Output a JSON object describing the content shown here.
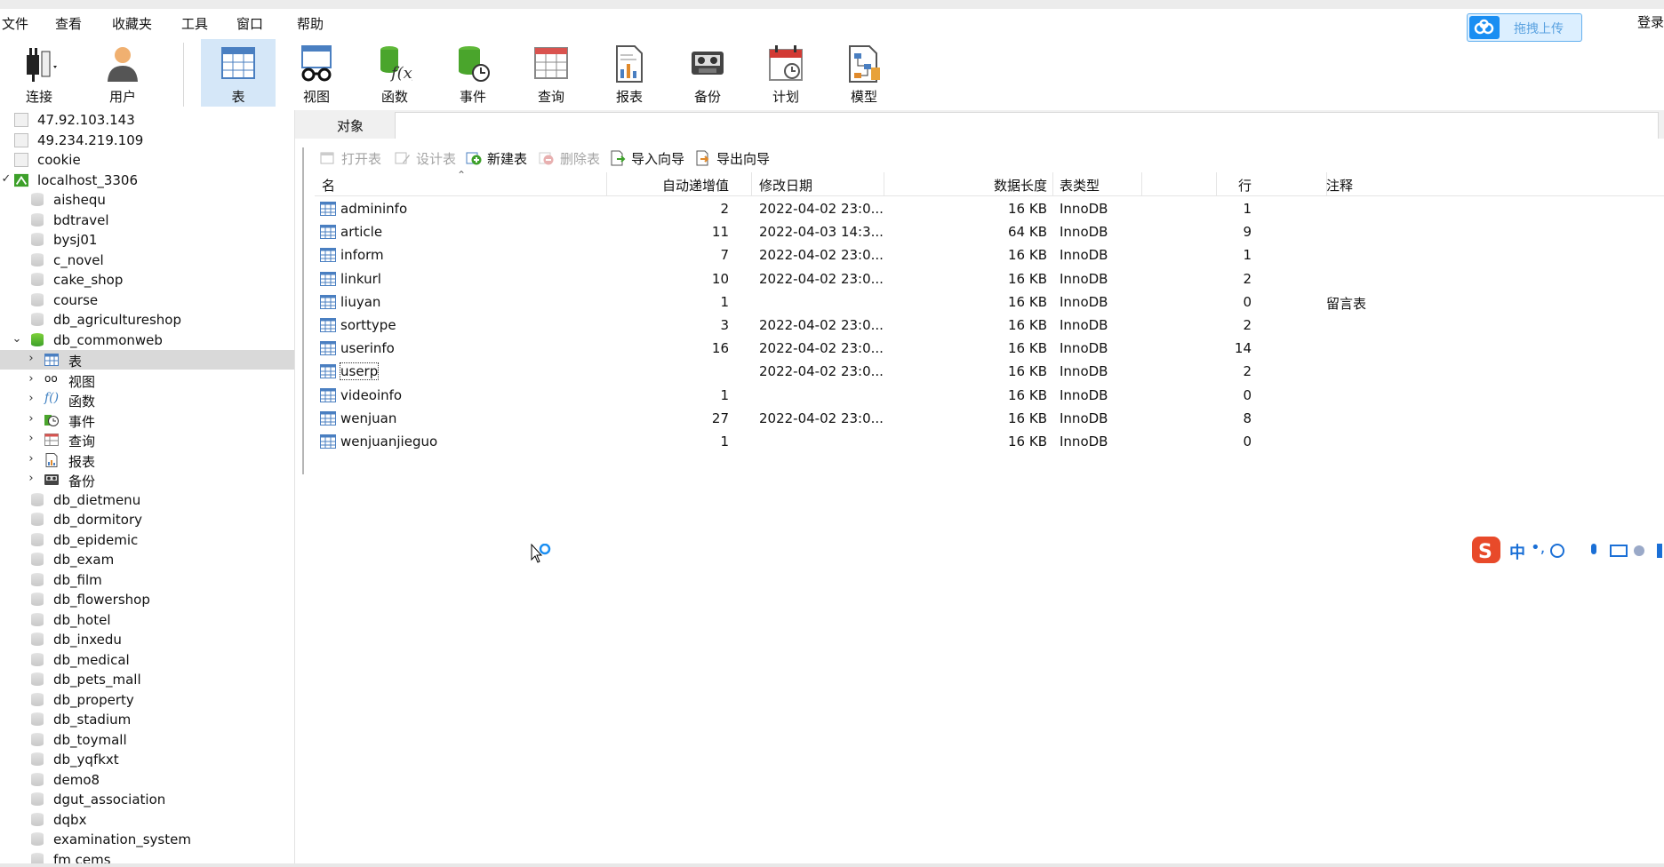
{
  "menu": [
    "文件",
    "查看",
    "收藏夹",
    "工具",
    "窗口",
    "帮助"
  ],
  "login": "登录",
  "upload": {
    "label": "拖拽上传"
  },
  "toolbar": {
    "connect": "连接",
    "user": "用户",
    "table": "表",
    "view": "视图",
    "function": "函数",
    "event": "事件",
    "query": "查询",
    "report": "报表",
    "backup": "备份",
    "schedule": "计划",
    "model": "模型"
  },
  "sidebar": {
    "connections": [
      "47.92.103.143",
      "49.234.219.109",
      "cookie",
      "localhost_3306"
    ],
    "dbs_before": [
      "aishequ",
      "bdtravel",
      "bysj01",
      "c_novel",
      "cake_shop",
      "course",
      "db_agricultureshop"
    ],
    "open_db": "db_commonweb",
    "children": [
      "表",
      "视图",
      "函数",
      "事件",
      "查询",
      "报表",
      "备份"
    ],
    "dbs_after": [
      "db_dietmenu",
      "db_dormitory",
      "db_epidemic",
      "db_exam",
      "db_film",
      "db_flowershop",
      "db_hotel",
      "db_inxedu",
      "db_medical",
      "db_pets_mall",
      "db_property",
      "db_stadium",
      "db_toymall",
      "db_yqfkxt",
      "demo8",
      "dgut_association",
      "dqbx",
      "examination_system",
      "fm cems"
    ]
  },
  "tab": {
    "objects": "对象"
  },
  "objtoolbar": {
    "open": "打开表",
    "design": "设计表",
    "new": "新建表",
    "delete": "删除表",
    "import": "导入向导",
    "export": "导出向导"
  },
  "columns": {
    "name": "名",
    "auto_inc": "自动递增值",
    "modified": "修改日期",
    "data_length": "数据长度",
    "engine": "表类型",
    "rows": "行",
    "comment": "注释"
  },
  "tables": [
    {
      "name": "admininfo",
      "auto_inc": "2",
      "modified": "2022-04-02 23:0...",
      "data_length": "16 KB",
      "engine": "InnoDB",
      "rows": "1",
      "comment": ""
    },
    {
      "name": "article",
      "auto_inc": "11",
      "modified": "2022-04-03 14:3...",
      "data_length": "64 KB",
      "engine": "InnoDB",
      "rows": "9",
      "comment": ""
    },
    {
      "name": "inform",
      "auto_inc": "7",
      "modified": "2022-04-02 23:0...",
      "data_length": "16 KB",
      "engine": "InnoDB",
      "rows": "1",
      "comment": ""
    },
    {
      "name": "linkurl",
      "auto_inc": "10",
      "modified": "2022-04-02 23:0...",
      "data_length": "16 KB",
      "engine": "InnoDB",
      "rows": "2",
      "comment": ""
    },
    {
      "name": "liuyan",
      "auto_inc": "1",
      "modified": "",
      "data_length": "16 KB",
      "engine": "InnoDB",
      "rows": "0",
      "comment": "留言表"
    },
    {
      "name": "sorttype",
      "auto_inc": "3",
      "modified": "2022-04-02 23:0...",
      "data_length": "16 KB",
      "engine": "InnoDB",
      "rows": "2",
      "comment": ""
    },
    {
      "name": "userinfo",
      "auto_inc": "16",
      "modified": "2022-04-02 23:0...",
      "data_length": "16 KB",
      "engine": "InnoDB",
      "rows": "14",
      "comment": ""
    },
    {
      "name": "userp",
      "auto_inc": "",
      "modified": "2022-04-02 23:0...",
      "data_length": "16 KB",
      "engine": "InnoDB",
      "rows": "2",
      "comment": ""
    },
    {
      "name": "videoinfo",
      "auto_inc": "1",
      "modified": "",
      "data_length": "16 KB",
      "engine": "InnoDB",
      "rows": "0",
      "comment": ""
    },
    {
      "name": "wenjuan",
      "auto_inc": "27",
      "modified": "2022-04-02 23:0...",
      "data_length": "16 KB",
      "engine": "InnoDB",
      "rows": "8",
      "comment": ""
    },
    {
      "name": "wenjuanjieguo",
      "auto_inc": "1",
      "modified": "",
      "data_length": "16 KB",
      "engine": "InnoDB",
      "rows": "0",
      "comment": ""
    }
  ],
  "ime": {
    "lang": "中"
  },
  "colors": {
    "accent": "#1a8ef2",
    "selected_tool": "#d5e7f8",
    "selected_tree": "#d9d9d9",
    "db_green": "#3da02a"
  }
}
